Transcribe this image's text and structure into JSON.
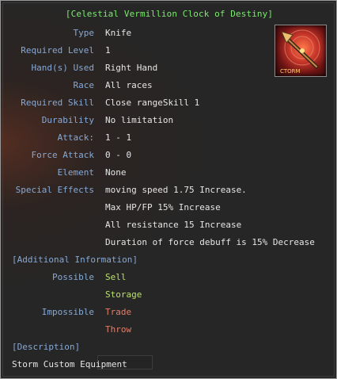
{
  "tooltip": {
    "title": "[Celestial Vermillion Clock of Destiny]",
    "icon_name": "weapon-icon",
    "icon_text": "CTORM",
    "rows": [
      {
        "label": "Type",
        "value": "Knife"
      },
      {
        "label": "Required Level",
        "value": "1"
      },
      {
        "label": "Hand(s) Used",
        "value": "Right Hand"
      },
      {
        "label": "Race",
        "value": "All races"
      },
      {
        "label": "Required Skill",
        "value": "Close rangeSkill 1"
      },
      {
        "label": "Durability",
        "value": "No limitation"
      },
      {
        "label": "Attack:",
        "value": "1 - 1"
      },
      {
        "label": "Force Attack",
        "value": "0 - 0"
      },
      {
        "label": "Element",
        "value": "None"
      }
    ],
    "special_effects": {
      "label": "Special Effects",
      "values": [
        "moving speed 1.75 Increase.",
        "Max HP/FP 15% Increase",
        "All resistance 15 Increase",
        "Duration of force debuff is 15% Decrease"
      ]
    },
    "additional_information": {
      "header": "[Additional Information]",
      "possible_label": "Possible",
      "possible_values": [
        "Sell",
        "Storage"
      ],
      "impossible_label": "Impossible",
      "impossible_values": [
        "Trade",
        "Throw"
      ]
    },
    "description": {
      "header": "[Description]",
      "text": "Storm Custom Equipment"
    }
  },
  "colors": {
    "title": "#7bea6c",
    "label": "#86a9d6",
    "value": "#e6e6e6",
    "possible": "#b9e06b",
    "impossible": "#e27e6a",
    "background": "#262626",
    "border": "#9a9a9a"
  }
}
